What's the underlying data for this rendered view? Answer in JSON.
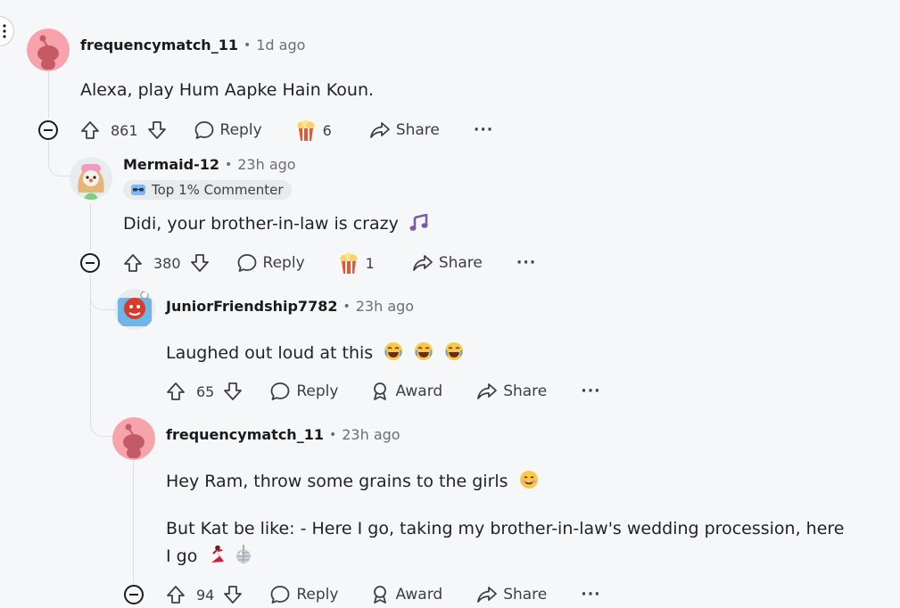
{
  "comments": [
    {
      "username": "frequencymatch_11",
      "time": "1d ago",
      "body": "Alexa, play Hum Aapke Hain Koun.",
      "score": "861",
      "reply": "Reply",
      "award_count": "6",
      "share": "Share",
      "more": "···"
    },
    {
      "username": "Mermaid-12",
      "time": "23h ago",
      "flair": "Top 1% Commenter",
      "body": "Didi, your brother-in-law is crazy",
      "score": "380",
      "reply": "Reply",
      "award_count": "1",
      "share": "Share",
      "more": "···"
    },
    {
      "username": "JuniorFriendship7782",
      "time": "23h ago",
      "body": "Laughed out loud at this",
      "score": "65",
      "reply": "Reply",
      "award": "Award",
      "share": "Share",
      "more": "···"
    },
    {
      "username": "frequencymatch_11",
      "time": "23h ago",
      "body_line1": "Hey Ram, throw some grains to the girls",
      "body_line2": "But Kat be like: - Here I go, taking my brother-in-law's wedding procession, here I go",
      "score": "94",
      "reply": "Reply",
      "award": "Award",
      "share": "Share",
      "more": "···"
    }
  ],
  "separator": "•",
  "icons": {
    "upvote": "upvote-arrow-icon",
    "downvote": "downvote-arrow-icon",
    "reply": "speech-bubble-icon",
    "award": "ribbon-award-icon",
    "popcorn": "popcorn-award-icon",
    "share": "share-arrow-icon",
    "collapse": "collapse-minus-icon",
    "emojis": [
      "musical-notes-emoji",
      "laughing-emoji",
      "smiling-emoji",
      "dancer-emoji",
      "disco-ball-emoji"
    ]
  },
  "colors": {
    "background": "#f6f7f8",
    "avatar_pink": "#f7a3ab",
    "text": "#1c1c1c",
    "muted": "#6a6f73",
    "thread_line": "#dcdfe2"
  }
}
